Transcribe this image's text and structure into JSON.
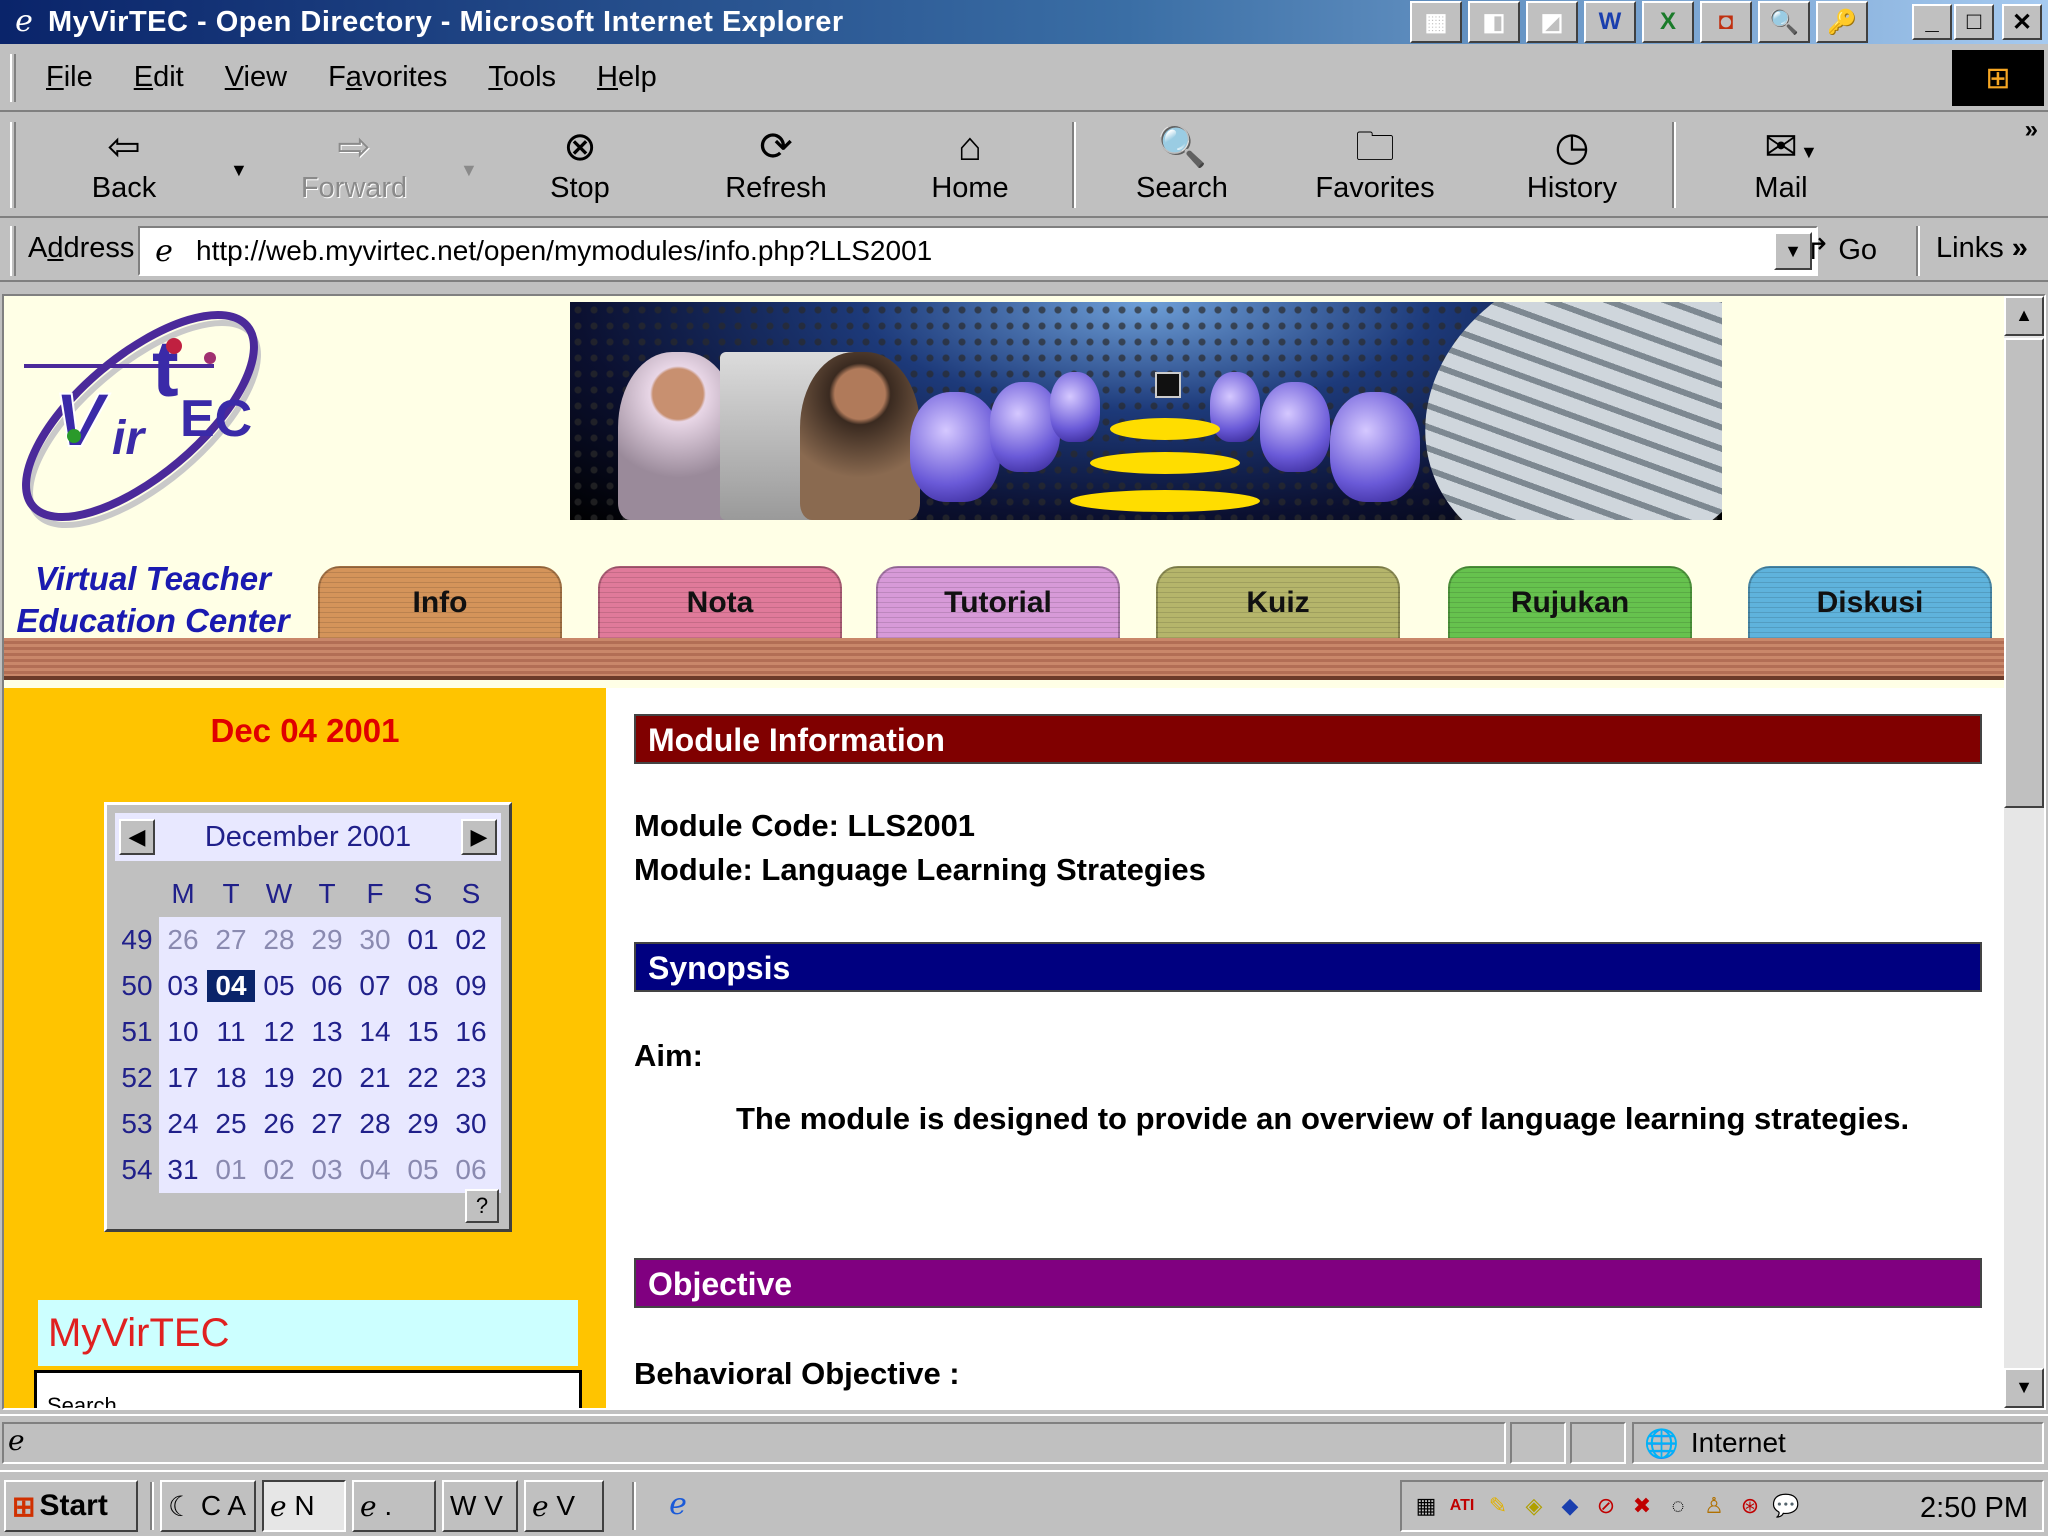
{
  "window": {
    "title": "MyVirTEC - Open Directory - Microsoft Internet Explorer",
    "tray_apps": [
      "▦",
      "◧",
      "◩",
      "W",
      "X",
      "◘",
      "🔍",
      "🔑"
    ],
    "controls": {
      "minimize": "_",
      "maximize": "□",
      "close": "✕"
    }
  },
  "menu": {
    "items": [
      {
        "mnemonic": "F",
        "rest": "ile"
      },
      {
        "mnemonic": "E",
        "rest": "dit"
      },
      {
        "mnemonic": "V",
        "rest": "iew"
      },
      {
        "pre": "F",
        "mnemonic": "a",
        "rest": "vorites"
      },
      {
        "mnemonic": "T",
        "rest": "ools"
      },
      {
        "mnemonic": "H",
        "rest": "elp"
      }
    ]
  },
  "toolbar": {
    "back": "Back",
    "forward": "Forward",
    "stop": "Stop",
    "refresh": "Refresh",
    "home": "Home",
    "search": "Search",
    "favorites": "Favorites",
    "history": "History",
    "mail": "Mail",
    "more": "»"
  },
  "address": {
    "label_pre": "A",
    "label_mnemonic": "d",
    "label_rest": "dress",
    "url": "http://web.myvirtec.net/open/mymodules/info.php?LLS2001",
    "go": "Go",
    "links": "Links",
    "links_more": "»"
  },
  "site": {
    "logo_text": "VirTEC",
    "tagline_line1": "Virtual Teacher",
    "tagline_line2": "Education Center",
    "tabs": [
      {
        "label": "Info",
        "color": "#d4945a"
      },
      {
        "label": "Nota",
        "color": "#e07a9a"
      },
      {
        "label": "Tutorial",
        "color": "#d79ad8"
      },
      {
        "label": "Kuiz",
        "color": "#b5b56b"
      },
      {
        "label": "Rujukan",
        "color": "#66c24e"
      },
      {
        "label": "Diskusi",
        "color": "#5fb3dc"
      }
    ]
  },
  "sidebar": {
    "date": "Dec 04 2001",
    "calendar": {
      "month": "December 2001",
      "weekdays": [
        "M",
        "T",
        "W",
        "T",
        "F",
        "S",
        "S"
      ],
      "weeks": [
        {
          "wk": "49",
          "days": [
            "26",
            "27",
            "28",
            "29",
            "30",
            "01",
            "02"
          ]
        },
        {
          "wk": "50",
          "days": [
            "03",
            "04",
            "05",
            "06",
            "07",
            "08",
            "09"
          ]
        },
        {
          "wk": "51",
          "days": [
            "10",
            "11",
            "12",
            "13",
            "14",
            "15",
            "16"
          ]
        },
        {
          "wk": "52",
          "days": [
            "17",
            "18",
            "19",
            "20",
            "21",
            "22",
            "23"
          ]
        },
        {
          "wk": "53",
          "days": [
            "24",
            "25",
            "26",
            "27",
            "28",
            "29",
            "30"
          ]
        },
        {
          "wk": "54",
          "days": [
            "31",
            "01",
            "02",
            "03",
            "04",
            "05",
            "06"
          ]
        }
      ],
      "help": "?"
    },
    "myvirtec": "MyVirTEC",
    "search_label": "Search"
  },
  "content": {
    "module_info_header": "Module Information",
    "module_code": "Module Code: LLS2001",
    "module_name": "Module: Language Learning Strategies",
    "synopsis_header": "Synopsis",
    "aim_label": "Aim:",
    "aim_text": "The module is designed to provide an overview of language learning strategies.",
    "objective_header": "Objective",
    "behavioral_label": "Behavioral Objective :",
    "colors": {
      "module_info": "#800000",
      "synopsis": "#000080",
      "objective": "#800080"
    }
  },
  "statusbar": {
    "zone": "Internet"
  },
  "taskbar": {
    "start": "Start",
    "tasks": [
      {
        "label": "C A"
      },
      {
        "label": "N",
        "active": true
      },
      {
        "label": "."
      },
      {
        "label": "V"
      },
      {
        "label": "V"
      }
    ],
    "clock": "2:50 PM"
  }
}
